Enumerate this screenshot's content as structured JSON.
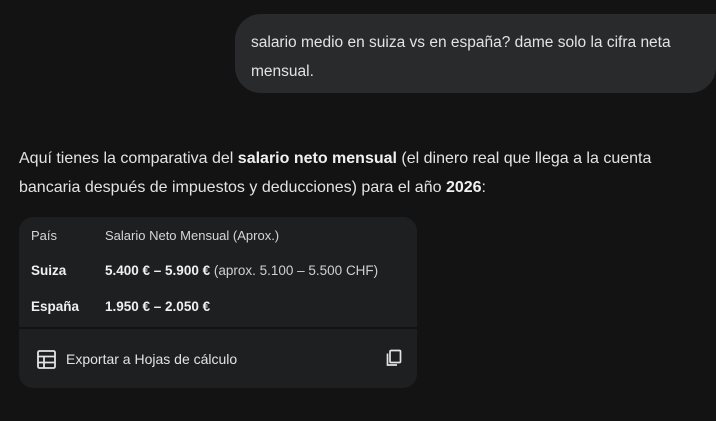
{
  "user_message": "salario medio en suiza vs en españa? dame solo la cifra neta mensual.",
  "response": {
    "intro_1": "Aquí tienes la comparativa del ",
    "intro_bold_1": "salario neto mensual",
    "intro_2": " (el dinero real que llega a la cuenta bancaria después de impuestos y deducciones) para el año ",
    "intro_bold_2": "2026",
    "intro_3": ":"
  },
  "table": {
    "headers": [
      "País",
      "Salario Neto Mensual (Aprox.)"
    ],
    "rows": [
      {
        "country": "Suiza",
        "value": "5.400 € – 5.900 €",
        "note": " (aprox. 5.100 – 5.500 CHF)"
      },
      {
        "country": "España",
        "value": "1.950 € – 2.050 €",
        "note": ""
      }
    ]
  },
  "actions": {
    "export_label": "Exportar a Hojas de cálculo",
    "export_icon": "table-icon",
    "copy_icon": "copy-icon"
  }
}
